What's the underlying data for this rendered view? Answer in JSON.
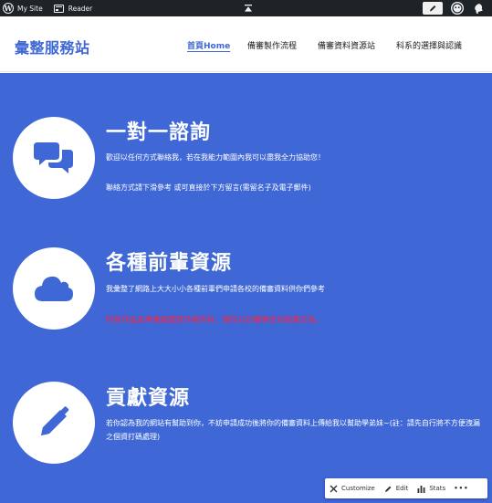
{
  "adminbar": {
    "my_site": "My Site",
    "reader": "Reader"
  },
  "site": {
    "title": "彙整服務站"
  },
  "nav": {
    "items": [
      "首頁Home",
      "備審製作流程",
      "備審資料資源站",
      "科系的選擇與認識"
    ]
  },
  "sections": [
    {
      "title": "一對一諮詢",
      "icon": "chat-bubbles-icon",
      "lines": [
        "歡迎以任何方式聯絡我，若在我能力範圍內我可以盡我全力協助您！",
        "聯絡方式請下滑參考 或可直接於下方留言(需留名子及電子郵件)"
      ]
    },
    {
      "title": "各種前輩資源",
      "icon": "cloud-icon",
      "lines": [
        "我彙整了網路上大大小小各種前輩們申請各校的備審資料供你們參考"
      ],
      "warning": "所有作品及準備留置原作者所有，請勿以抄襲等任何商業行為。"
    },
    {
      "title": "貢獻資源",
      "icon": "pencil-icon",
      "paragraph": "若你認為我的網站有幫助到你，不妨申請成功後將你的備審資料上傳給我以幫助學弟妹~(註：請先自行將不方便洩漏之個資打碼處理)"
    }
  ],
  "toolbar": {
    "customize": "Customize",
    "edit": "Edit",
    "stats": "Stats",
    "more": "•••"
  },
  "colors": {
    "brand_blue": "#3f68d6",
    "admin_bar": "#1d2327",
    "warning_red": "#ff1f3d"
  }
}
